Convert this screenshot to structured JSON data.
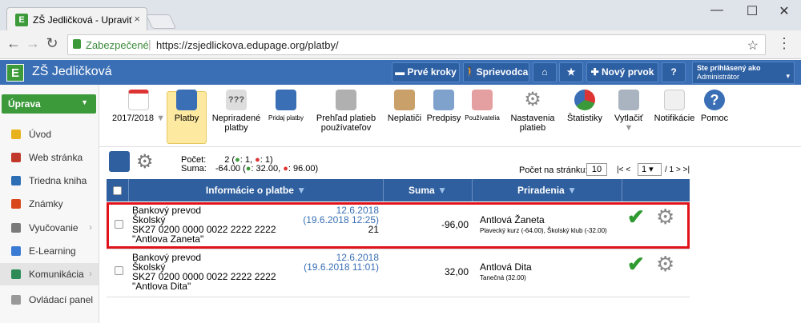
{
  "browser": {
    "tab_title": "ZŠ Jedličková - Upraviť v:",
    "tab_close": "×",
    "security_label": "Zabezpečené",
    "url": "https://zsjedlickova.edupage.org/platby/",
    "window_controls": {
      "minimize": "—",
      "maximize": "☐",
      "close": "✕"
    }
  },
  "header": {
    "app_title": "ZŠ Jedličková",
    "logo_letter": "E",
    "first_steps": "Prvé kroky",
    "guide": "Sprievodca",
    "new_item": "Nový prvok",
    "help": "?",
    "user_line1": "Ste prihlásený ako",
    "user_line2": "Administrátor"
  },
  "sidebar": {
    "menu_button": "Úprava",
    "items": [
      {
        "label": "Úvod",
        "color": "#e8b21c"
      },
      {
        "label": "Web stránka",
        "color": "#c0392b"
      },
      {
        "label": "Triedna kniha",
        "color": "#2c6fb5"
      },
      {
        "label": "Známky",
        "color": "#d9481c"
      },
      {
        "label": "Vyučovanie",
        "color": "#7a7a7a"
      },
      {
        "label": "E-Learning",
        "color": "#3a7bd5"
      },
      {
        "label": "Komunikácia",
        "color": "#2e8b57"
      },
      {
        "label": "Ovládací panel",
        "color": "#999999"
      }
    ]
  },
  "toolbar": {
    "year": "2017/2018",
    "items": [
      {
        "label": "Platby"
      },
      {
        "label": "Nepriradené platby"
      },
      {
        "label": "Pridaj platby"
      },
      {
        "label": "Prehľad platieb používateľov"
      },
      {
        "label": "Neplatiči"
      },
      {
        "label": "Predpisy"
      },
      {
        "label": "Používatelia"
      },
      {
        "label": "Nastavenia platieb"
      },
      {
        "label": "Štatistiky"
      },
      {
        "label": "Vytlačiť"
      },
      {
        "label": "Notifikácie"
      },
      {
        "label": "Pomoc"
      }
    ]
  },
  "summary": {
    "count_label": "Počet:",
    "count_value": "2 (",
    "count_plus": ": 1,",
    "count_minus": ": 1)",
    "sum_label": "Suma:",
    "sum_value": "-64.00 (",
    "sum_plus": ": 32.00,",
    "sum_minus": ": 96.00)",
    "per_page_label": "Počet na stránku:",
    "per_page_value": "10",
    "pager_prev": "|< <",
    "pager_page": "1",
    "pager_total": "/ 1",
    "pager_next": "> >|"
  },
  "table": {
    "col_info": "Informácie o platbe",
    "col_sum": "Suma",
    "col_assign": "Priradenia",
    "rows": [
      {
        "type": "Bankový prevod",
        "bank": "Školský",
        "account": "SK27 0200 0000 0022 2222 2222",
        "name": "\"Antlova Zaneta\"",
        "date": "12.6.2018",
        "date2": "(19.6.2018 12:25)",
        "ref": "21",
        "sum": "-96,00",
        "assignee": "Antlová Žaneta",
        "detail": "Plavecký kurz (-64.00), Školský klub (-32.00)"
      },
      {
        "type": "Bankový prevod",
        "bank": "Školský",
        "account": "SK27 0200 0000 0022 2222 2222",
        "name": "\"Antlova Dita\"",
        "date": "12.6.2018",
        "date2": "(19.6.2018 11:01)",
        "ref": "",
        "sum": "32,00",
        "assignee": "Antlová Dita",
        "detail": "Tanečná (32.00)"
      }
    ]
  }
}
